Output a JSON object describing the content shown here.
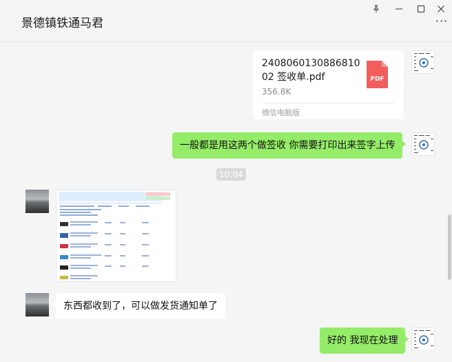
{
  "window": {
    "title": "景德镇铁通马君",
    "pin_icon": "pin-icon",
    "minimize_icon": "minimize-icon",
    "maximize_icon": "maximize-icon",
    "close_icon": "close-icon",
    "more_label": "···"
  },
  "messages": {
    "file": {
      "name": "240806013088681002 签收单.pdf",
      "size": "356.8K",
      "source": "微信电脑版",
      "icon_label": "PDF",
      "icon_color": "#f25d5d"
    },
    "text1": "一般都是用这两个做签收  你需要打印出来签字上传",
    "time": "10:04",
    "text2": "东西都收到了，可以做发货通知单了",
    "text3": "好的 我现在处理"
  },
  "colors": {
    "self_bubble": "#95ec69",
    "other_bubble": "#ffffff",
    "background": "#f5f5f5"
  }
}
